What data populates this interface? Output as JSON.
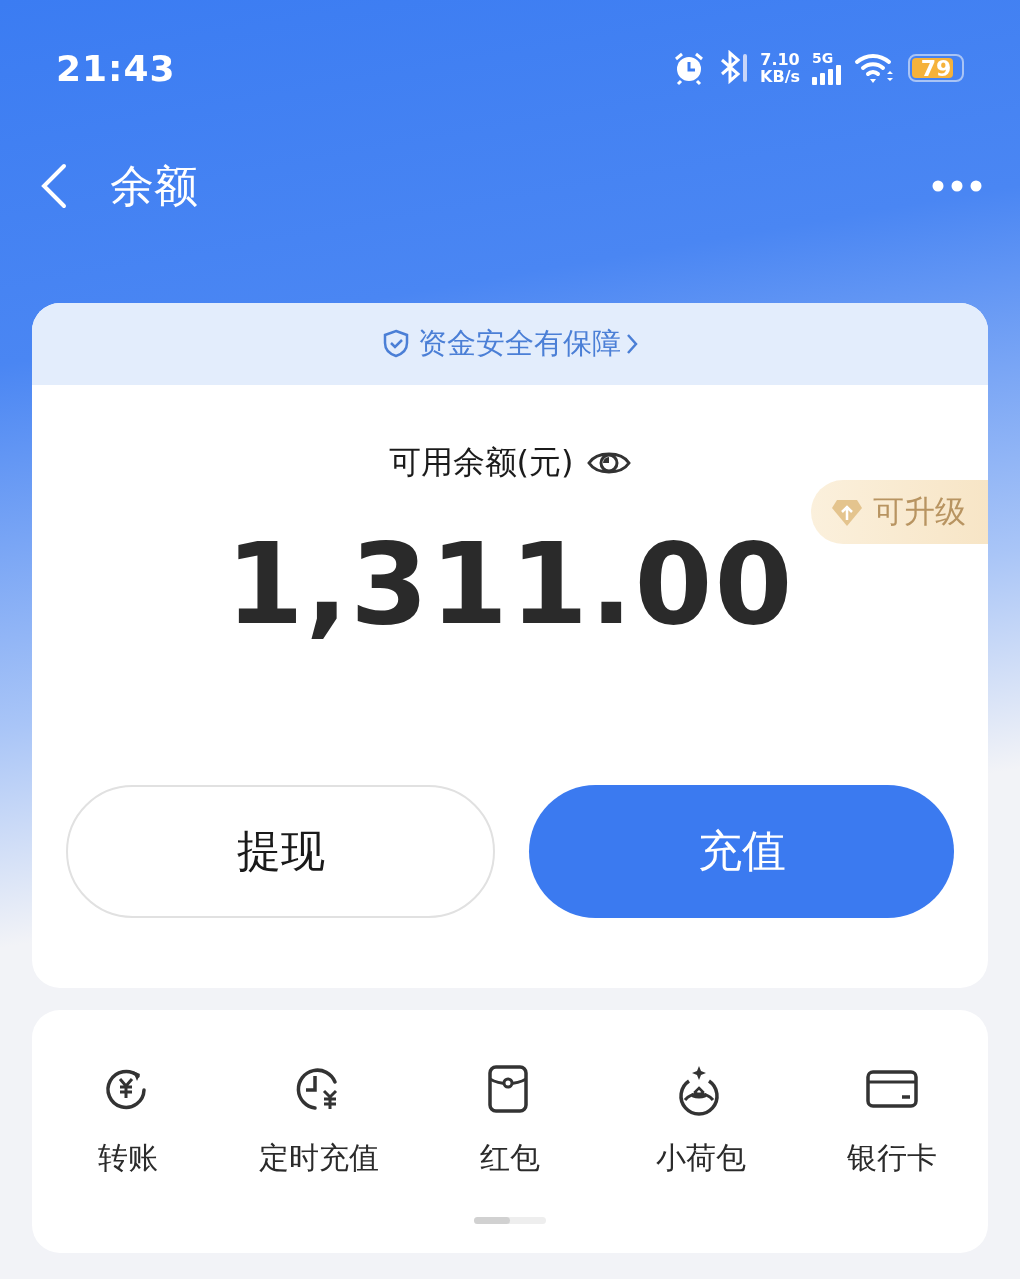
{
  "status_bar": {
    "time": "21:43",
    "speed_value": "7.10",
    "speed_unit": "KB/s",
    "network": "5G",
    "battery": "79"
  },
  "nav": {
    "title": "余额"
  },
  "balance_card": {
    "banner": "资金安全有保障",
    "label": "可用余额(元)",
    "badge": "可升级",
    "amount": "1,311.00",
    "buttons": [
      {
        "label": "提现",
        "kind": "outline"
      },
      {
        "label": "充值",
        "kind": "primary"
      }
    ]
  },
  "shortcuts": [
    {
      "label": "转账"
    },
    {
      "label": "定时充值"
    },
    {
      "label": "红包"
    },
    {
      "label": "小荷包"
    },
    {
      "label": "银行卡"
    }
  ]
}
